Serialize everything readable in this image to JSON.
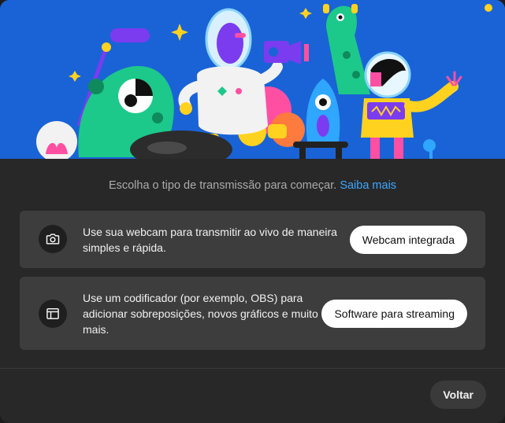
{
  "intro": {
    "text": "Escolha o tipo de transmissão para começar.",
    "link": "Saiba mais"
  },
  "options": [
    {
      "icon": "camera-icon",
      "description": "Use sua webcam para transmitir ao vivo de maneira simples e rápida.",
      "button": "Webcam integrada"
    },
    {
      "icon": "encoder-layout-icon",
      "description": "Use um codificador (por exemplo, OBS) para adicionar sobreposições, novos gráficos e muito mais.",
      "button": "Software para streaming"
    }
  ],
  "footer": {
    "back_label": "Voltar"
  },
  "colors": {
    "hero_background": "#1a63d6",
    "link": "#3ea6ff",
    "card": "#3d3d3d",
    "dialog": "#282828"
  }
}
